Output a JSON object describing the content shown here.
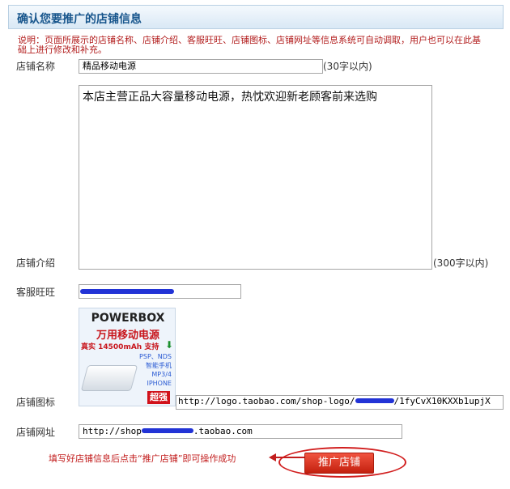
{
  "header": {
    "title": "确认您要推广的店铺信息"
  },
  "notice": "说明：页面所展示的店铺名称、店铺介绍、客服旺旺、店铺图标、店铺网址等信息系统可自动调取，用户也可以在此基础上进行修改和补充。",
  "form": {
    "shop_name": {
      "label": "店铺名称",
      "value": "精品移动电源",
      "hint": "(30字以内)"
    },
    "shop_intro": {
      "label": "店铺介绍",
      "value": "本店主营正品大容量移动电源，热忱欢迎新老顾客前来选购",
      "hint": "(300字以内)"
    },
    "service_wangwang": {
      "label": "客服旺旺",
      "value": ""
    },
    "shop_icon": {
      "label": "店铺图标",
      "logo": {
        "brand": "POWERBOX",
        "name": "万用移动电源",
        "spec": "真实 14500mAh 支持",
        "devices": "PSP、NDS\n智能手机\nMP3/4\nIPHONE",
        "badge": "超强"
      },
      "url_start": "http://logo.taobao.com/shop-logo/",
      "url_end": "/1fyCvX10KXXb1upjX"
    },
    "shop_url": {
      "label": "店铺网址",
      "prefix": "http://shop",
      "suffix": ".taobao.com"
    }
  },
  "instruction": "填写好店铺信息后点击“推广店铺”即可操作成功",
  "promote_button": "推广店铺",
  "colors": {
    "accent_red": "#c8161d",
    "header_blue": "#17558c",
    "redaction": "#2233d6"
  }
}
